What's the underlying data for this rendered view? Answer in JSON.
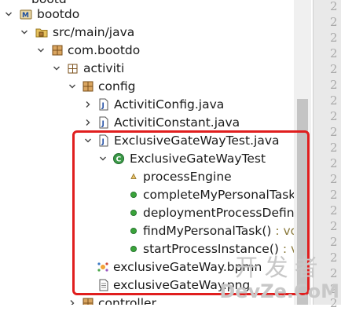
{
  "tree": {
    "top_partial_label": "bootd",
    "project_label": "bootdo",
    "src_label": "src/main/java",
    "pkg_com_label": "com.bootdo",
    "pkg_activiti_label": "activiti",
    "pkg_config_label": "config",
    "file_activiti_config": "ActivitiConfig.java",
    "file_activiti_constant": "ActivitiConstant.java",
    "file_exclusive_test_java": "ExclusiveGateWayTest.java",
    "class_exclusive_test": "ExclusiveGateWayTest",
    "members": [
      {
        "name": "processEngine",
        "ret": ""
      },
      {
        "name": "completeMyPersonalTask()",
        "ret": ""
      },
      {
        "name": "deploymentProcessDefinit",
        "ret": ""
      },
      {
        "name": "findMyPersonalTask()",
        "ret": " : voic"
      },
      {
        "name": "startProcessInstance()",
        "ret": " : voi"
      }
    ],
    "file_bpmn": "exclusiveGateWay.bpmn",
    "file_png": "exclusiveGateWay.png",
    "pkg_controller_partial": "controller"
  },
  "gutter_numbers": [
    "2",
    "2",
    "2",
    "2",
    "2",
    "2",
    "2",
    "2",
    "2",
    "2",
    "2",
    "2",
    "2",
    "2",
    "2",
    "2",
    "2",
    "2",
    "2",
    "2"
  ],
  "watermark": {
    "cn": "开发者",
    "en": "DevZe.CoM"
  },
  "colors": {
    "highlight": "#e01e1e",
    "package": "#b07b33",
    "class": "#2e8b3c",
    "method": "#3aa33a"
  }
}
